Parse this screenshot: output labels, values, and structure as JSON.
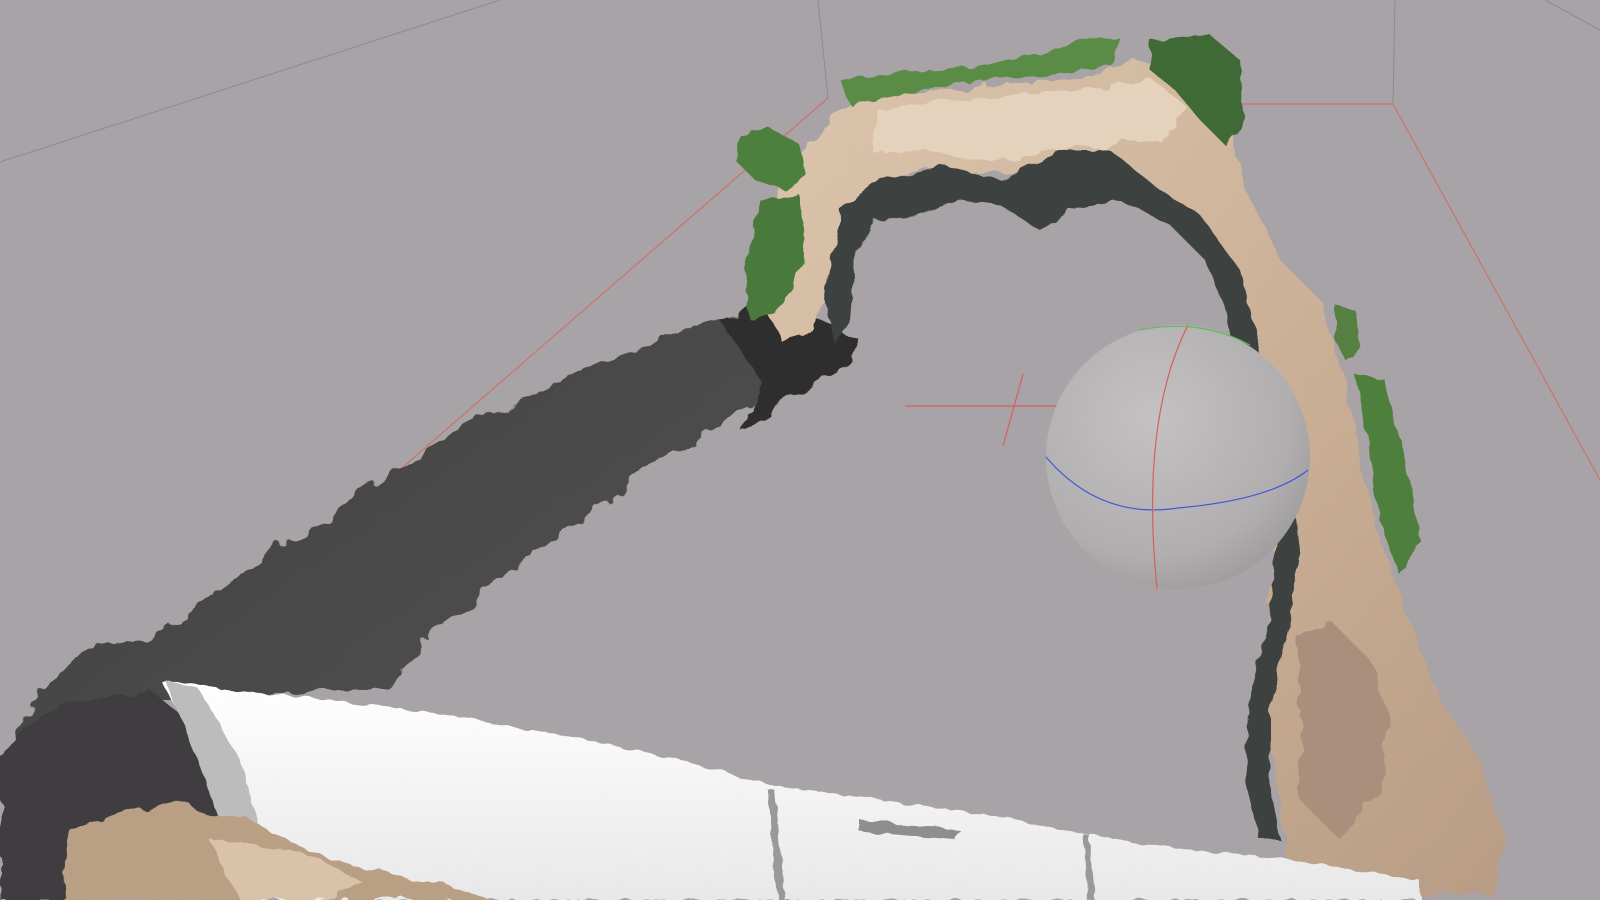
{
  "viewer": {
    "background_color": "#a8a3a6",
    "bounding_box_color": "#d46a5c",
    "grid_line_color": "#8f8a8d",
    "navigation_sphere_fill": "#b3b0b2",
    "axis_colors": {
      "x": "#d4605a",
      "y": "#5bbf4f",
      "z": "#3f59d6"
    },
    "point_cloud_colors": {
      "ground": "#c9b29a",
      "ground_light": "#ddc8b0",
      "vegetation": "#4f8a3a",
      "vegetation_dark": "#2f4a2c",
      "shadow_side": "#474646",
      "concrete": "#f2f2f2"
    }
  }
}
